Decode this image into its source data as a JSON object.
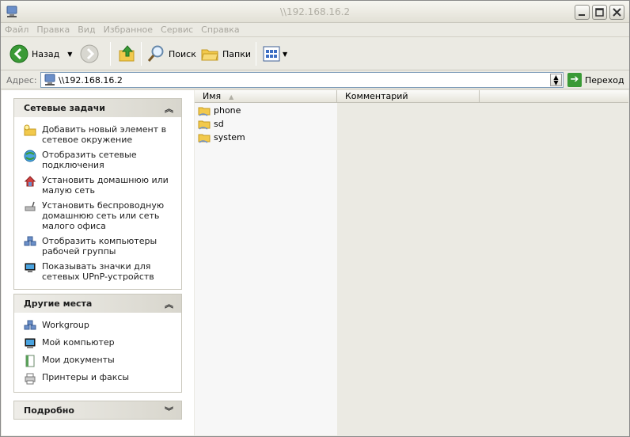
{
  "window": {
    "title": "\\\\192.168.16.2"
  },
  "menu": [
    "Файл",
    "Правка",
    "Вид",
    "Избранное",
    "Сервис",
    "Справка"
  ],
  "toolbar": {
    "back": "Назад",
    "search": "Поиск",
    "folders": "Папки"
  },
  "address": {
    "label": "Адрес:",
    "value": "\\\\192.168.16.2",
    "go": "Переход"
  },
  "network_tasks": {
    "title": "Сетевые задачи",
    "items": [
      {
        "label": "Добавить новый элемент в сетевое окружение",
        "icon": "add-network-place-icon"
      },
      {
        "label": "Отобразить сетевые подключения",
        "icon": "network-connections-icon"
      },
      {
        "label": "Установить домашнюю или малую сеть",
        "icon": "home-network-icon"
      },
      {
        "label": "Установить беспроводную домашнюю сеть или сеть малого офиса",
        "icon": "wireless-network-icon"
      },
      {
        "label": "Отобразить компьютеры рабочей группы",
        "icon": "workgroup-computers-icon"
      },
      {
        "label": "Показывать значки для сетевых UPnP-устройств",
        "icon": "upnp-devices-icon"
      }
    ]
  },
  "other_places": {
    "title": "Другие места",
    "items": [
      {
        "label": "Workgroup",
        "icon": "workgroup-icon"
      },
      {
        "label": "Мой компьютер",
        "icon": "my-computer-icon"
      },
      {
        "label": "Мои документы",
        "icon": "my-documents-icon"
      },
      {
        "label": "Принтеры и факсы",
        "icon": "printers-icon"
      }
    ]
  },
  "details": {
    "title": "Подробно"
  },
  "columns": [
    "Имя",
    "Комментарий"
  ],
  "files": [
    "phone",
    "sd",
    "system"
  ],
  "colors": {
    "title_bg": "#ebeae3",
    "pane_bg": "#ffffff",
    "accent_green": "#3a9a36",
    "folder": "#f2c94c"
  }
}
